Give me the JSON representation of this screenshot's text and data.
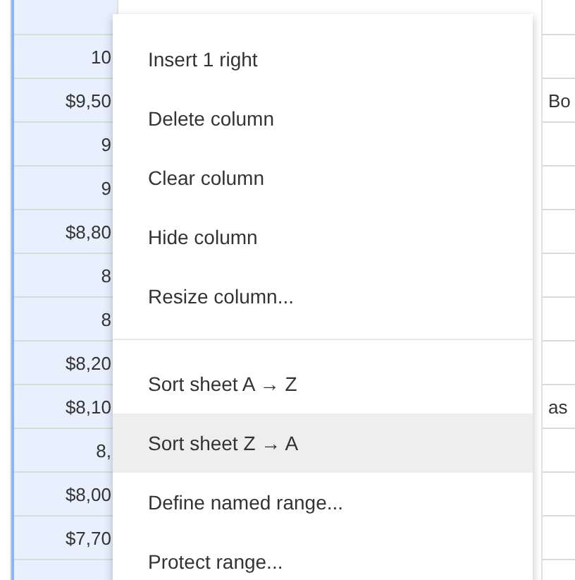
{
  "sheet": {
    "column_a": {
      "selected": true
    },
    "rows": [
      {
        "column_a": "10"
      },
      {
        "column_a": "$9,50",
        "column_c": "Bo"
      },
      {
        "column_a": "9"
      },
      {
        "column_a": "9"
      },
      {
        "column_a": "$8,80"
      },
      {
        "column_a": "8"
      },
      {
        "column_a": "8"
      },
      {
        "column_a": "$8,20"
      },
      {
        "column_a": "$8,10",
        "column_c": "as"
      },
      {
        "column_a": "8,"
      },
      {
        "column_a": "$8,00"
      },
      {
        "column_a": "$7,70"
      }
    ]
  },
  "context_menu": {
    "items": [
      {
        "kind": "item",
        "label": "Insert 1 right",
        "selected": false
      },
      {
        "kind": "item",
        "label": "Delete column",
        "selected": false
      },
      {
        "kind": "item",
        "label": "Clear column",
        "selected": false
      },
      {
        "kind": "item",
        "label": "Hide column",
        "selected": false
      },
      {
        "kind": "item",
        "label": "Resize column...",
        "selected": false
      },
      {
        "kind": "separator"
      },
      {
        "kind": "item",
        "label": "Sort sheet A → Z",
        "selected": false
      },
      {
        "kind": "item",
        "label": "Sort sheet Z → A",
        "selected": true
      },
      {
        "kind": "item",
        "label": "Define named range...",
        "selected": false
      },
      {
        "kind": "item",
        "label": "Protect range...",
        "selected": false
      }
    ]
  }
}
